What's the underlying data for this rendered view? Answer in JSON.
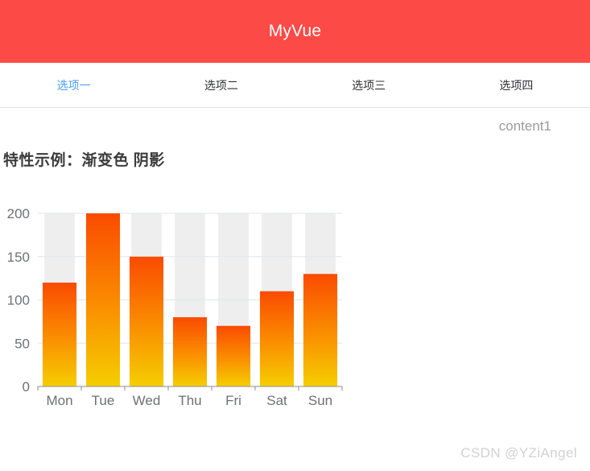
{
  "header": {
    "title": "MyVue",
    "background_color": "#fc4a46",
    "title_color": "#ffffff"
  },
  "tabs": {
    "active_index": 0,
    "active_color": "#4a9ff5",
    "inactive_color": "#303133",
    "items": [
      {
        "label": "选项一"
      },
      {
        "label": "选项二"
      },
      {
        "label": "选项三"
      },
      {
        "label": "选项四"
      }
    ]
  },
  "content": {
    "panel_label": "content1",
    "section_title": "特性示例：渐变色 阴影"
  },
  "watermark": {
    "text": "CSDN @YZiAngel"
  },
  "chart_data": {
    "type": "bar",
    "title": "",
    "subtitle": "",
    "xlabel": "",
    "ylabel": "",
    "categories": [
      "Mon",
      "Tue",
      "Wed",
      "Thu",
      "Fri",
      "Sat",
      "Sun"
    ],
    "values": [
      120,
      200,
      150,
      80,
      70,
      110,
      130
    ],
    "series": [
      {
        "name": "",
        "values": [
          120,
          200,
          150,
          80,
          70,
          110,
          130
        ]
      }
    ],
    "ylim": [
      0,
      200
    ],
    "y_ticks": [
      0,
      50,
      100,
      150,
      200
    ],
    "y_tick_labels": [
      "0",
      "50",
      "100",
      "150",
      "200"
    ],
    "grid": true,
    "grid_color": "#e0e6f1",
    "legend": "none",
    "bar_gradient": {
      "top": "#fa4b00",
      "middle": "#fa9000",
      "bottom": "#f5ce00"
    },
    "category_band_color": "#eeeeee",
    "axis_line_color": "#8c8c8c",
    "tick_label_color": "#6e7079"
  }
}
